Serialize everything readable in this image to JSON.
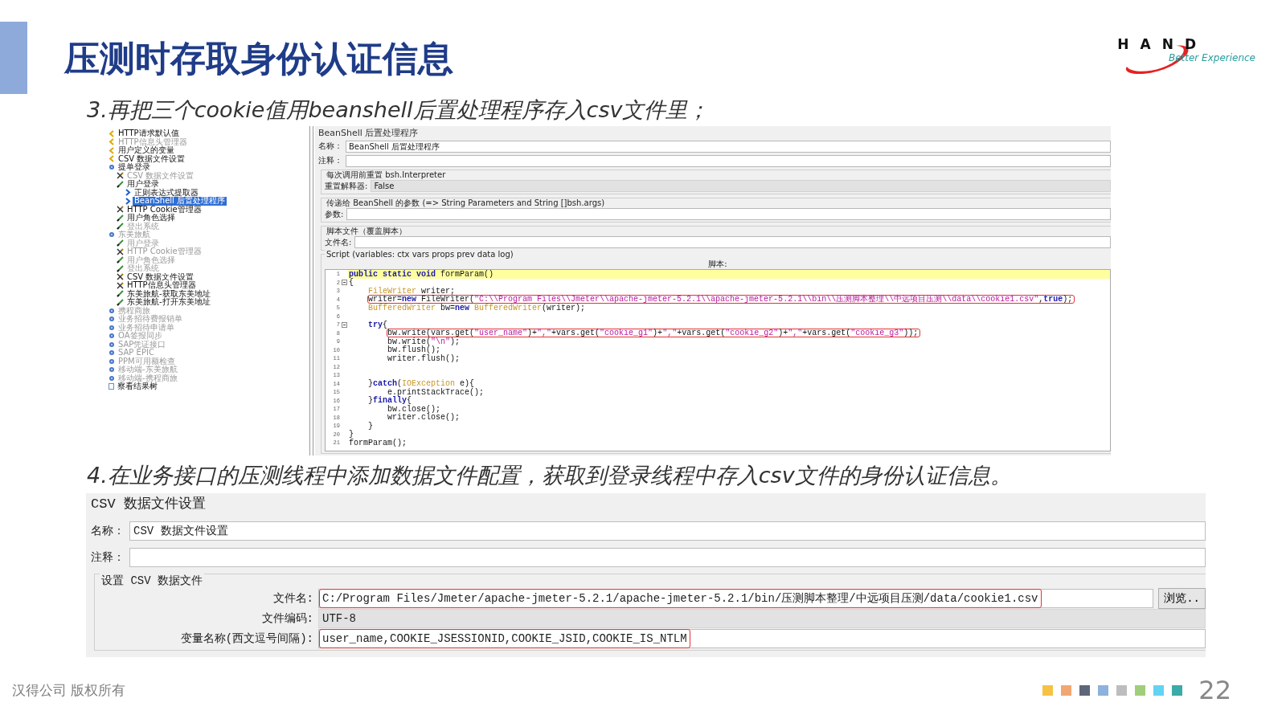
{
  "title": "压测时存取身份认证信息",
  "logo": {
    "letters": "HAND",
    "tagline": "Better Experience"
  },
  "step_3": "3.再把三个cookie值用beanshell后置处理程序存入csv文件里；",
  "tree": [
    {
      "label": "HTTP请求默认值",
      "kind": "config",
      "disabled": false,
      "selected": false
    },
    {
      "label": "HTTP信息头管理器",
      "kind": "config",
      "disabled": true,
      "selected": false
    },
    {
      "label": "用户定义的变量",
      "kind": "config",
      "disabled": false,
      "selected": false
    },
    {
      "label": "CSV 数据文件设置",
      "kind": "config",
      "disabled": false,
      "selected": false
    },
    {
      "label": "提单登录",
      "kind": "thread",
      "disabled": false,
      "selected": false,
      "children": [
        {
          "label": "CSV 数据文件设置",
          "kind": "tool",
          "disabled": true,
          "selected": false
        },
        {
          "label": "用户登录",
          "kind": "sampler",
          "disabled": false,
          "selected": false,
          "children": [
            {
              "label": "正则表达式提取器",
              "kind": "post",
              "disabled": false,
              "selected": false
            },
            {
              "label": "BeanShell 后置处理程序",
              "kind": "post",
              "disabled": false,
              "selected": true
            }
          ]
        },
        {
          "label": "HTTP Cookie管理器",
          "kind": "tool",
          "disabled": false,
          "selected": false
        },
        {
          "label": "用户角色选择",
          "kind": "sampler",
          "disabled": false,
          "selected": false
        },
        {
          "label": "登出系统",
          "kind": "sampler",
          "disabled": true,
          "selected": false
        }
      ]
    },
    {
      "label": "东美旅航",
      "kind": "thread",
      "disabled": true,
      "selected": false,
      "children": [
        {
          "label": "用户登录",
          "kind": "sampler",
          "disabled": true,
          "selected": false
        },
        {
          "label": "HTTP Cookie管理器",
          "kind": "tool",
          "disabled": true,
          "selected": false
        },
        {
          "label": "用户角色选择",
          "kind": "sampler",
          "disabled": true,
          "selected": false
        },
        {
          "label": "登出系统",
          "kind": "sampler",
          "disabled": true,
          "selected": false
        },
        {
          "label": "CSV 数据文件设置",
          "kind": "tool",
          "disabled": false,
          "selected": false
        },
        {
          "label": "HTTP信息头管理器",
          "kind": "tool",
          "disabled": false,
          "selected": false
        },
        {
          "label": "东美旅航-获取东美地址",
          "kind": "sampler",
          "disabled": false,
          "selected": false
        },
        {
          "label": "东美旅航-打开东美地址",
          "kind": "sampler",
          "disabled": false,
          "selected": false
        }
      ]
    },
    {
      "label": "携程商旅",
      "kind": "thread",
      "disabled": true,
      "selected": false
    },
    {
      "label": "业务招待费报销单",
      "kind": "thread",
      "disabled": true,
      "selected": false
    },
    {
      "label": "业务招待申请单",
      "kind": "thread",
      "disabled": true,
      "selected": false
    },
    {
      "label": "OA签报同步",
      "kind": "thread",
      "disabled": true,
      "selected": false
    },
    {
      "label": "SAP凭证接口",
      "kind": "thread",
      "disabled": true,
      "selected": false
    },
    {
      "label": "SAP EPIC",
      "kind": "thread",
      "disabled": true,
      "selected": false
    },
    {
      "label": "PPM可用额检查",
      "kind": "thread",
      "disabled": true,
      "selected": false
    },
    {
      "label": "移动端-东美旅航",
      "kind": "thread",
      "disabled": true,
      "selected": false
    },
    {
      "label": "移动端-携程商旅",
      "kind": "thread",
      "disabled": true,
      "selected": false
    },
    {
      "label": "察看结果树",
      "kind": "listener",
      "disabled": false,
      "selected": false
    }
  ],
  "beanshell": {
    "title": "BeanShell 后置处理程序",
    "fields": [
      {
        "label": "名称：",
        "value": "BeanShell 后置处理程序"
      },
      {
        "label": "注释："
      }
    ],
    "groups": [
      {
        "legend": "每次调用前重置 bsh.Interpreter",
        "label": "重置解释器:",
        "value": "False",
        "kind": "readonly"
      },
      {
        "legend": "传递给 BeanShell 的参数 (=> String Parameters and String []bsh.args)",
        "label": "参数:",
        "kind": "editable"
      },
      {
        "legend": "脚本文件（覆盖脚本）",
        "label": "文件名:",
        "kind": "editable"
      }
    ],
    "script": {
      "legend": "Script (variables: ctx vars props prev data log)",
      "heading": "脚本:",
      "lines": [
        {
          "number": "1",
          "highlighted": true,
          "boxed": false,
          "fold": false,
          "segments": [
            {
              "kind": "keyword",
              "text": "public static void"
            },
            {
              "kind": "plain",
              "text": " formParam()"
            }
          ]
        },
        {
          "number": "2",
          "highlighted": false,
          "boxed": false,
          "fold": true,
          "segments": [
            {
              "kind": "plain",
              "text": "{"
            }
          ]
        },
        {
          "number": "3",
          "highlighted": false,
          "boxed": false,
          "fold": false,
          "kind": "block",
          "segments": [
            {
              "kind": "type",
              "text": "FileWriter"
            },
            {
              "kind": "plain",
              "text": " writer;"
            }
          ]
        },
        {
          "number": "4",
          "highlighted": false,
          "boxed": true,
          "fold": false,
          "kind": "block",
          "segments": [
            {
              "kind": "plain",
              "text": "writer="
            },
            {
              "kind": "keyword",
              "text": "new"
            },
            {
              "kind": "plain",
              "text": " FileWriter"
            },
            {
              "kind": "plain",
              "text": "("
            },
            {
              "kind": "string",
              "text": "\"C:\\\\Program Files\\\\Jmeter\\\\apache-jmeter-5.2.1\\\\apache-jmeter-5.2.1\\\\bin\\\\压测脚本整理\\\\中远项目压测\\\\data\\\\cookie1.csv\""
            },
            {
              "kind": "plain",
              "text": ","
            },
            {
              "kind": "keyword",
              "text": "true"
            },
            {
              "kind": "plain",
              "text": ");"
            }
          ]
        },
        {
          "number": "5",
          "highlighted": false,
          "boxed": false,
          "fold": false,
          "kind": "block",
          "segments": [
            {
              "kind": "type",
              "text": "BufferedWriter"
            },
            {
              "kind": "plain",
              "text": " bw="
            },
            {
              "kind": "keyword",
              "text": "new"
            },
            {
              "kind": "type",
              "text": " BufferedWriter"
            },
            {
              "kind": "plain",
              "text": "(writer);"
            }
          ]
        },
        {
          "number": "6",
          "highlighted": false,
          "boxed": false,
          "fold": false
        },
        {
          "number": "7",
          "highlighted": false,
          "boxed": false,
          "fold": true,
          "kind": "block",
          "segments": [
            {
              "kind": "keyword",
              "text": "try"
            },
            {
              "kind": "plain",
              "text": "{"
            }
          ]
        },
        {
          "number": "8",
          "highlighted": false,
          "boxed": true,
          "fold": false,
          "kind": "inner",
          "segments": [
            {
              "kind": "plain",
              "text": "bw.write(vars.get("
            },
            {
              "kind": "string",
              "text": "\"user_name\""
            },
            {
              "kind": "plain",
              "text": ")+"
            },
            {
              "kind": "string",
              "text": "\",\""
            },
            {
              "kind": "plain",
              "text": "+vars.get("
            },
            {
              "kind": "string",
              "text": "\"cookie_g1\""
            },
            {
              "kind": "plain",
              "text": ")+"
            },
            {
              "kind": "string",
              "text": "\",\""
            },
            {
              "kind": "plain",
              "text": "+vars.get("
            },
            {
              "kind": "string",
              "text": "\"cookie_g2\""
            },
            {
              "kind": "plain",
              "text": ")+"
            },
            {
              "kind": "string",
              "text": "\",\""
            },
            {
              "kind": "plain",
              "text": "+vars.get("
            },
            {
              "kind": "string",
              "text": "\"cookie_g3\""
            },
            {
              "kind": "plain",
              "text": "));"
            }
          ]
        },
        {
          "number": "9",
          "highlighted": false,
          "boxed": false,
          "fold": false,
          "kind": "inner",
          "segments": [
            {
              "kind": "plain",
              "text": "bw.write("
            },
            {
              "kind": "string",
              "text": "\"\\n\""
            },
            {
              "kind": "plain",
              "text": ");"
            }
          ]
        },
        {
          "number": "10",
          "highlighted": false,
          "boxed": false,
          "fold": false,
          "kind": "inner",
          "segments": [
            {
              "kind": "plain",
              "text": "bw.flush();"
            }
          ]
        },
        {
          "number": "11",
          "highlighted": false,
          "boxed": false,
          "fold": false,
          "kind": "inner",
          "segments": [
            {
              "kind": "plain",
              "text": "writer.flush();"
            }
          ]
        },
        {
          "number": "12",
          "highlighted": false,
          "boxed": false,
          "fold": false
        },
        {
          "number": "13",
          "highlighted": false,
          "boxed": false,
          "fold": false
        },
        {
          "number": "14",
          "highlighted": false,
          "boxed": false,
          "fold": false,
          "kind": "block",
          "segments": [
            {
              "kind": "plain",
              "text": "}"
            },
            {
              "kind": "keyword",
              "text": "catch"
            },
            {
              "kind": "plain",
              "text": "("
            },
            {
              "kind": "type",
              "text": "IOException"
            },
            {
              "kind": "plain",
              "text": " e){"
            }
          ]
        },
        {
          "number": "15",
          "highlighted": false,
          "boxed": false,
          "fold": false,
          "kind": "inner",
          "segments": [
            {
              "kind": "plain",
              "text": "e.printStackTrace();"
            }
          ]
        },
        {
          "number": "16",
          "highlighted": false,
          "boxed": false,
          "fold": false,
          "kind": "block",
          "segments": [
            {
              "kind": "plain",
              "text": "}"
            },
            {
              "kind": "keyword",
              "text": "finally"
            },
            {
              "kind": "plain",
              "text": "{"
            }
          ]
        },
        {
          "number": "17",
          "highlighted": false,
          "boxed": false,
          "fold": false,
          "kind": "inner",
          "segments": [
            {
              "kind": "plain",
              "text": "bw.close();"
            }
          ]
        },
        {
          "number": "18",
          "highlighted": false,
          "boxed": false,
          "fold": false,
          "kind": "inner",
          "segments": [
            {
              "kind": "plain",
              "text": "writer.close();"
            }
          ]
        },
        {
          "number": "19",
          "highlighted": false,
          "boxed": false,
          "fold": false,
          "kind": "block",
          "segments": [
            {
              "kind": "plain",
              "text": "}"
            }
          ]
        },
        {
          "number": "20",
          "highlighted": false,
          "boxed": false,
          "fold": false,
          "segments": [
            {
              "kind": "plain",
              "text": "}"
            }
          ]
        },
        {
          "number": "21",
          "highlighted": false,
          "boxed": false,
          "fold": false,
          "segments": [
            {
              "kind": "plain",
              "text": "formParam();"
            }
          ]
        }
      ]
    }
  },
  "step_4": "4.在业务接口的压测线程中添加数据文件配置，获取到登录线程中存入csv文件的身份认证信息。",
  "csv_config": {
    "title": "CSV 数据文件设置",
    "fields": [
      {
        "label": "名称：",
        "value": "CSV 数据文件设置"
      },
      {
        "label": "注释："
      }
    ],
    "group": {
      "legend": "设置 CSV 数据文件",
      "rows": [
        {
          "label": "文件名:",
          "value": "C:/Program Files/Jmeter/apache-jmeter-5.2.1/apache-jmeter-5.2.1/bin/压测脚本整理/中远项目压测/data/cookie1.csv",
          "kind": "editable",
          "highlighted": true,
          "button": "浏览.."
        },
        {
          "label": "文件编码:",
          "value": "UTF-8",
          "kind": "readonly",
          "highlighted": false
        },
        {
          "label": "变量名称(西文逗号间隔):",
          "value": "user_name,COOKIE_JSESSIONID,COOKIE_JSID,COOKIE_IS_NTLM",
          "kind": "editable",
          "highlighted": true
        }
      ]
    }
  },
  "footer": "汉得公司 版权所有",
  "page_number": "22"
}
